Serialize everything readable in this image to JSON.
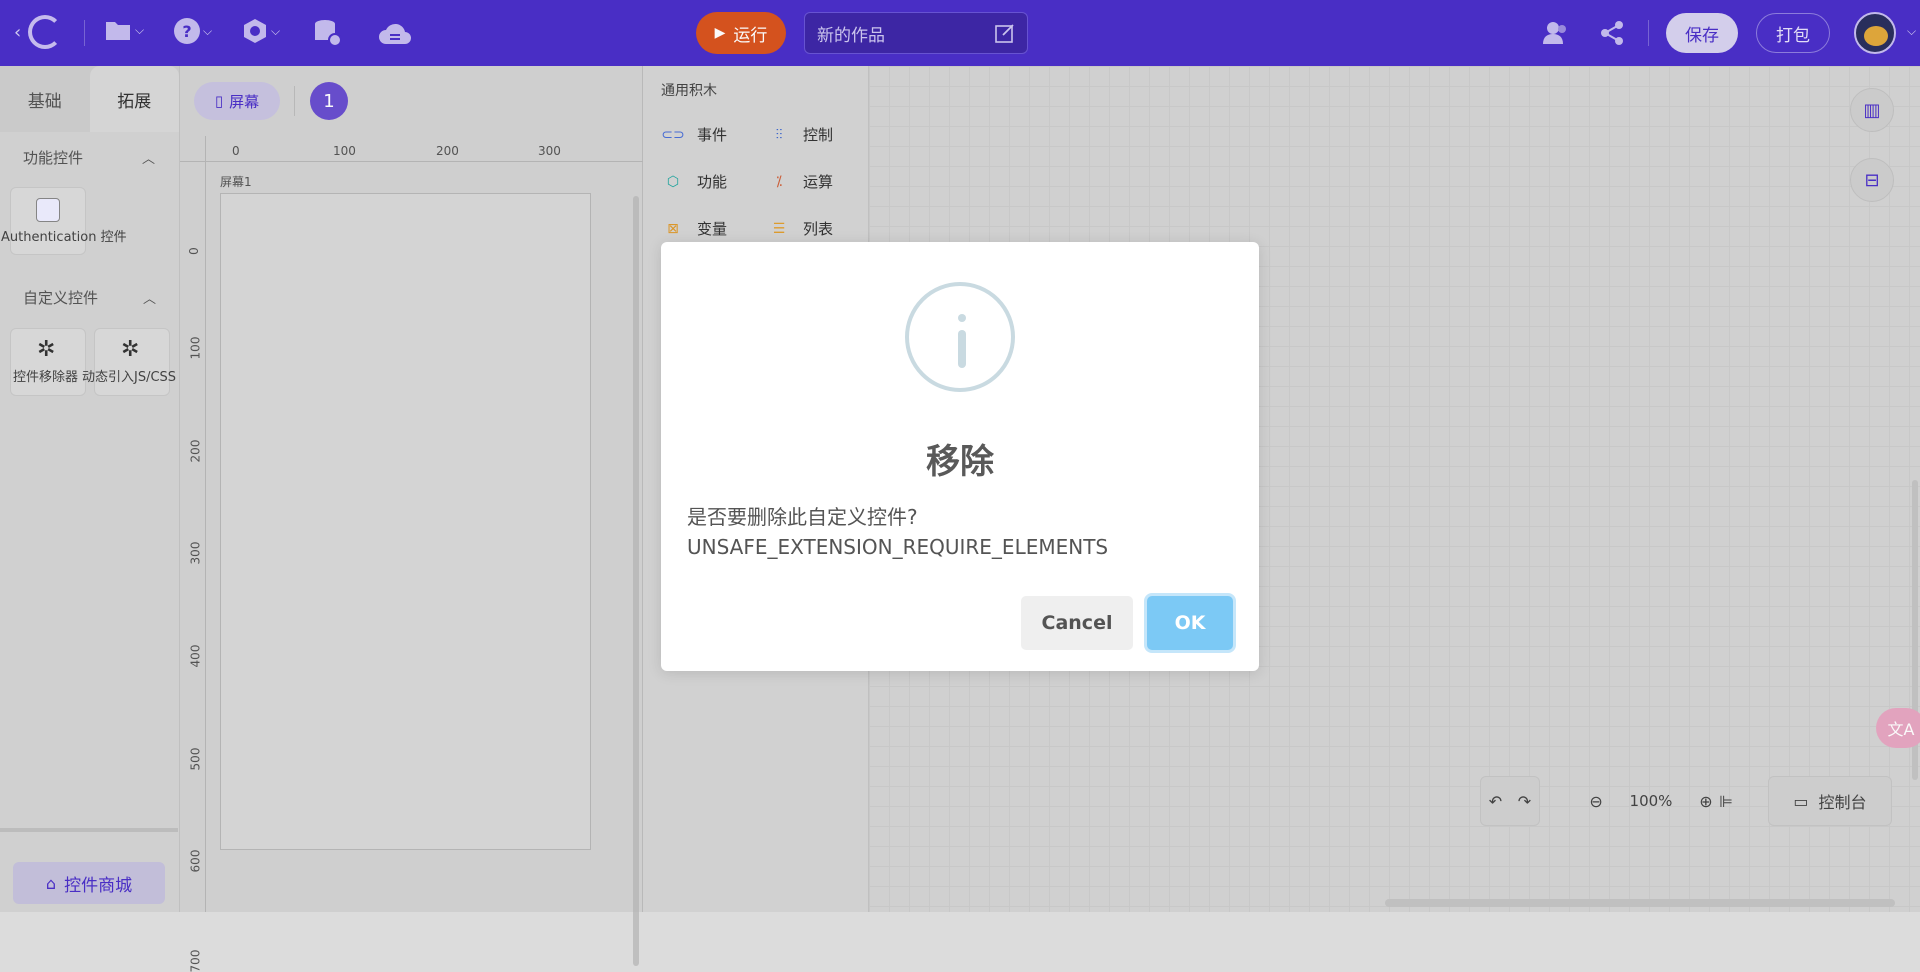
{
  "topbar": {
    "run_label": "运行",
    "project_title": "新的作品",
    "save_label": "保存",
    "package_label": "打包"
  },
  "sidebar": {
    "tabs": [
      "基础",
      "拓展"
    ],
    "section_functional": "功能控件",
    "auth_tile_label": "Authentication 控件",
    "section_custom": "自定义控件",
    "custom_tiles": [
      "控件移除器",
      "动态引入JS/CSS"
    ],
    "shop_label": "控件商城"
  },
  "canvas": {
    "screen_label": "屏幕",
    "screen_count": "1",
    "screen_name": "屏幕1",
    "ruler_top": [
      "0",
      "100",
      "200",
      "300"
    ],
    "ruler_left": [
      "0",
      "100",
      "200",
      "300",
      "400",
      "500",
      "600",
      "700"
    ]
  },
  "blocks": {
    "header": "通用积木",
    "items": [
      "事件",
      "控制",
      "功能",
      "运算",
      "变量",
      "列表"
    ]
  },
  "bottombar": {
    "zoom": "100%",
    "console_label": "控制台"
  },
  "dialog": {
    "title": "移除",
    "message_line1": "是否要删除此自定义控件?",
    "message_line2": "UNSAFE_EXTENSION_REQUIRE_ELEMENTS",
    "cancel_label": "Cancel",
    "ok_label": "OK"
  },
  "colors": {
    "topbar": "#4b2fc9",
    "run_button": "#d9541f",
    "ok_button": "#7cc9f5",
    "info_icon": "#c9dae1"
  },
  "icons": [
    "back-icon",
    "logo-icon",
    "folder-icon",
    "help-icon",
    "settings-icon",
    "database-icon",
    "cloud-icon",
    "play-icon",
    "edit-icon",
    "collaborators-icon",
    "share-icon",
    "avatar",
    "chart-icon",
    "store-icon",
    "undo-icon",
    "redo-icon",
    "zoom-out-icon",
    "zoom-in-icon",
    "align-icon",
    "monitor-icon",
    "info-icon",
    "translate-icon"
  ]
}
